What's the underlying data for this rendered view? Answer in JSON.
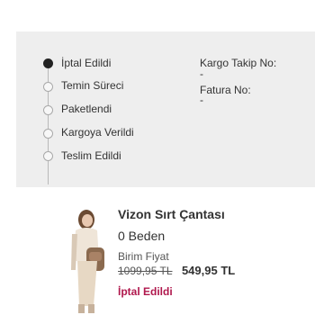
{
  "order_status": {
    "steps": [
      {
        "label": "İptal Edildi",
        "active": true
      },
      {
        "label": "Temin Süreci",
        "active": false
      },
      {
        "label": "Paketlendi",
        "active": false
      },
      {
        "label": "Kargoya Verildi",
        "active": false
      },
      {
        "label": "Teslim Edildi",
        "active": false
      }
    ]
  },
  "shipping_info": {
    "tracking_label": "Kargo Takip No:",
    "tracking_value": "-",
    "invoice_label": "Fatura No:",
    "invoice_value": "-"
  },
  "product": {
    "name": "Vizon Sırt Çantası",
    "size": "0 Beden",
    "price_label": "Birim Fiyat",
    "old_price": "1099,95 TL",
    "new_price": "549,95 TL",
    "status": "İptal Edildi"
  },
  "colors": {
    "panel_background": "#eeeeee",
    "cancelled_status": "#b0184d",
    "active_dot": "#222222"
  },
  "icons": {
    "active_step": "filled-circle-icon",
    "inactive_step": "empty-circle-icon"
  }
}
